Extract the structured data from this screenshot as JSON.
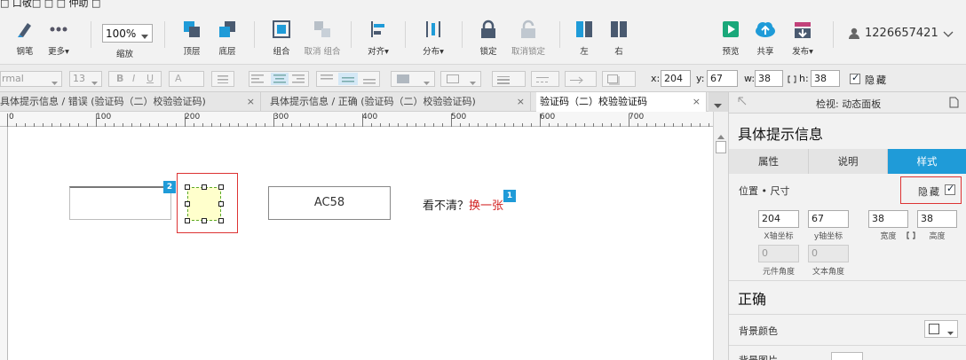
{
  "menubar": {
    "partial": "□ 口敬□ □ □ 仲助 □"
  },
  "toolbar": {
    "pen": "钢笔",
    "more": "更多▾",
    "zoom": "100%",
    "zoom_label": "缩放",
    "top_layer": "顶层",
    "bottom_layer": "底层",
    "group": "组合",
    "ungroup": "取消 组合",
    "align": "对齐▾",
    "distribute": "分布▾",
    "lock": "锁定",
    "unlock": "取消锁定",
    "left": "左",
    "right": "右",
    "preview": "预览",
    "share": "共享",
    "publish": "发布▾",
    "user": "1226657421"
  },
  "format": {
    "font": "rmal",
    "size": "13",
    "x_label": "x:",
    "x": "204",
    "y_label": "y:",
    "y": "67",
    "w_label": "w:",
    "w": "38",
    "h_label": "h:",
    "h": "38",
    "hide_label": "隐藏"
  },
  "tabs": [
    {
      "label": "具体提示信息 / 错误 (验证码（二）校验验证码)",
      "close": "×"
    },
    {
      "label": "具体提示信息 / 正确 (验证码（二）校验验证码)",
      "close": "×"
    },
    {
      "label": "验证码（二）校验验证码",
      "close": "×"
    }
  ],
  "ruler": {
    "ticks": [
      "0",
      "100",
      "200",
      "300",
      "400",
      "500",
      "600",
      "700",
      "80"
    ]
  },
  "canvas": {
    "badge2": "2",
    "badge1": "1",
    "captcha_text": "AC58",
    "cant_see": "看不清？",
    "change": "换一张"
  },
  "panel": {
    "header": "检视: 动态面板",
    "title": "具体提示信息",
    "tabs": [
      "属性",
      "说明",
      "样式"
    ],
    "pos_size_label": "位置 • 尺寸",
    "hide_label": "隐藏",
    "x": "204",
    "y": "67",
    "w": "38",
    "h": "38",
    "x_caption": "X轴坐标",
    "y_caption": "y轴坐标",
    "w_caption": "宽度",
    "h_caption": "高度",
    "rot1": "0",
    "rot2": "0",
    "rot1_caption": "元件角度",
    "rot2_caption": "文本角度",
    "state_name": "正确",
    "bg_color_label": "背景颜色",
    "bg_image_label": "背景图片"
  },
  "colors": {
    "accent": "#1f9bd8",
    "red": "#d22222",
    "selection_fill": "#ffffcc",
    "badge": "#1f9bd8"
  }
}
